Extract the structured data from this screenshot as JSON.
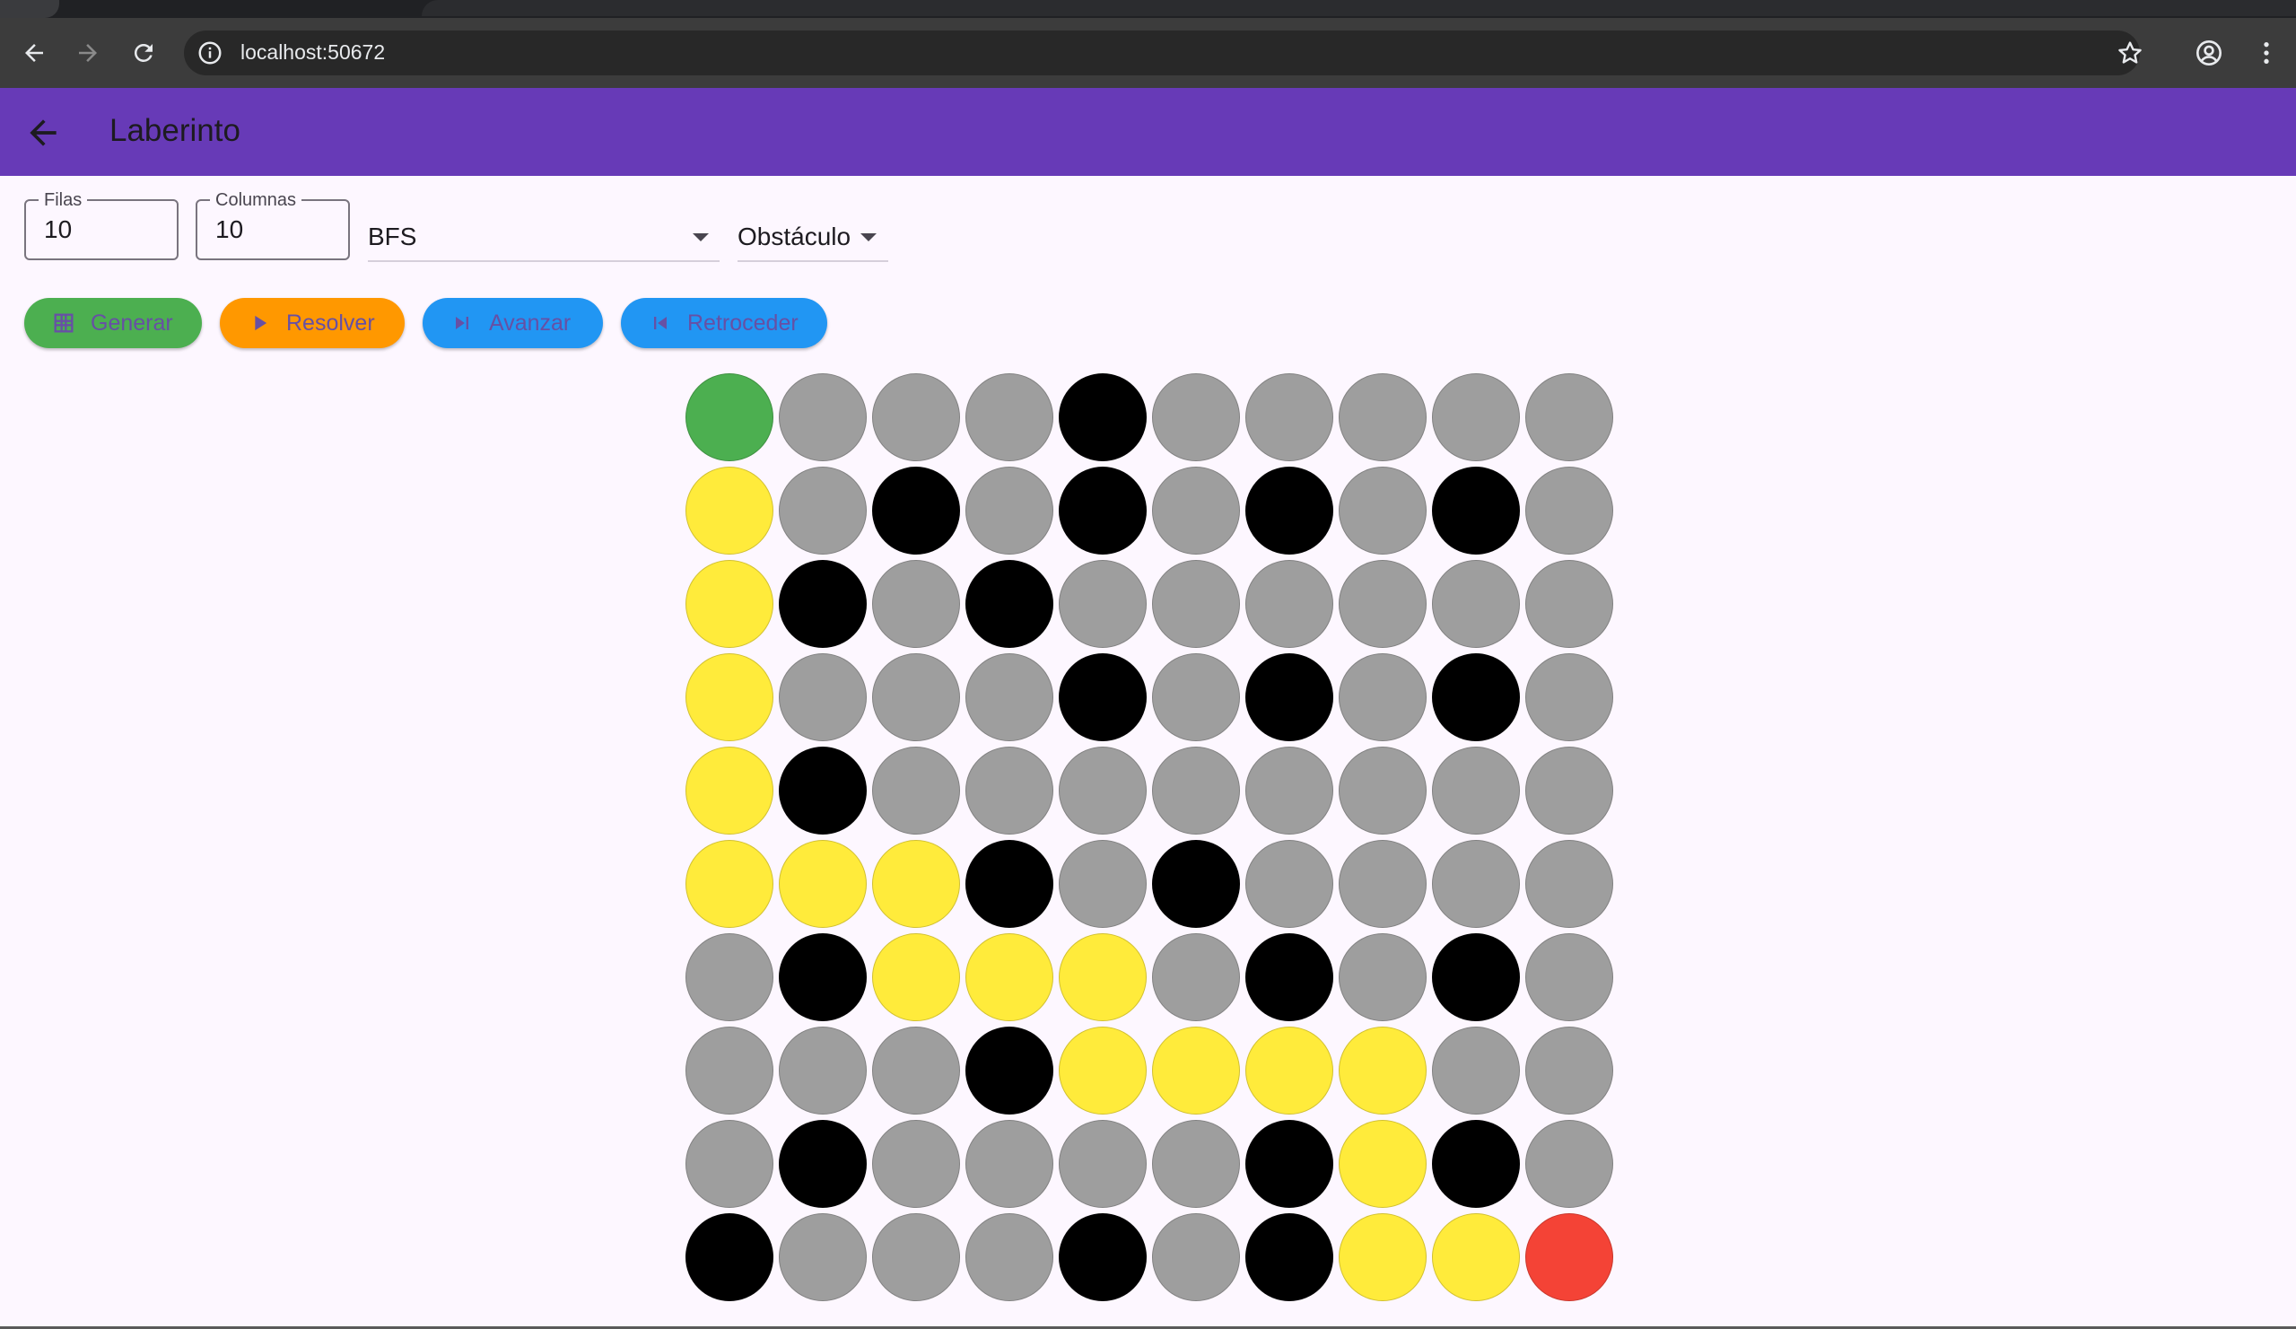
{
  "browser": {
    "url": "localhost:50672"
  },
  "app": {
    "title": "Laberinto"
  },
  "controls": {
    "rows_label": "Filas",
    "rows_value": "10",
    "cols_label": "Columnas",
    "cols_value": "10",
    "algorithm": "BFS",
    "tool": "Obstáculo"
  },
  "buttons": {
    "generate": "Generar",
    "solve": "Resolver",
    "step_forward": "Avanzar",
    "step_back": "Retroceder"
  },
  "colors": {
    "app_bar": "#673ab7",
    "generate_btn": "#4caf50",
    "solve_btn": "#ff9800",
    "step_btn": "#2196f3",
    "start": "#4caf50",
    "end": "#f44336",
    "wall": "#000000",
    "empty": "#9e9e9e",
    "path": "#ffeb3b"
  },
  "maze": {
    "legend_codes": "S=start, E=end, W=wall, P=path, .=empty",
    "rows": [
      "S...W.....",
      "P.W.W.W.W.",
      "PW.W......",
      "P...W.W.W.",
      "PW........",
      "PPPW.W....",
      ".WPPP.W.W.",
      "...WPPPP..",
      ".W....WPW.",
      "W...W.WPPE"
    ]
  }
}
